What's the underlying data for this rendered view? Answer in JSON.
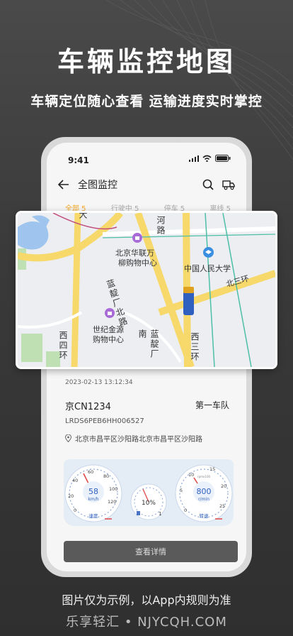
{
  "headline": "车辆监控地图",
  "subline": "车辆定位随心查看 运输进度实时掌控",
  "status_time": "9:41",
  "appbar": {
    "title": "全图监控"
  },
  "filters": [
    {
      "label": "全部 5"
    },
    {
      "label": "行驶中 5"
    },
    {
      "label": "停车 5"
    },
    {
      "label": "离线 5"
    }
  ],
  "map": {
    "poi_1": "北京华联万",
    "poi_1b": "柳购物中心",
    "poi_2": "中国人民大学",
    "poi_3": "世纪金源",
    "poi_3b": "购物中心",
    "road_1": "河路",
    "road_2": "北三环",
    "road_3": "蓝靛厂北路",
    "road_4": "西四环",
    "road_5": "西三环",
    "road_6": "蓝靛厂南",
    "road_7": "大"
  },
  "vehicle": {
    "timestamp": "2023-02-13  13:12:34",
    "plate": "京CN1234",
    "team": "第一车队",
    "vin": "LRDS6PEB6HH006527",
    "address": "北京市昌平区沙阳路北京市昌平区沙阳路"
  },
  "dashboard": {
    "speed_value": "58",
    "speed_unit": "km/h",
    "speed_label": "速度",
    "speed_ticks": [
      "0",
      "20",
      "40",
      "60",
      "80",
      "100",
      "120"
    ],
    "fuel_value": "10%",
    "fuel_mark": "1",
    "rpm_value": "800",
    "rpm_unit": "r/min",
    "rpm_label": "转速",
    "rpm_ticks": [
      "0",
      "5",
      "10",
      "15",
      "20",
      "25"
    ],
    "rpm_small": "rpmx100"
  },
  "detail_button": "查看详情",
  "footer_note": "图片仅为示例，以App内规则为准",
  "brand": "乐享轻汇 • NJYCQH.COM",
  "colors": {
    "accent": "#f5a623",
    "truck": "#2f5fbf",
    "road_major": "#f6d86b"
  }
}
